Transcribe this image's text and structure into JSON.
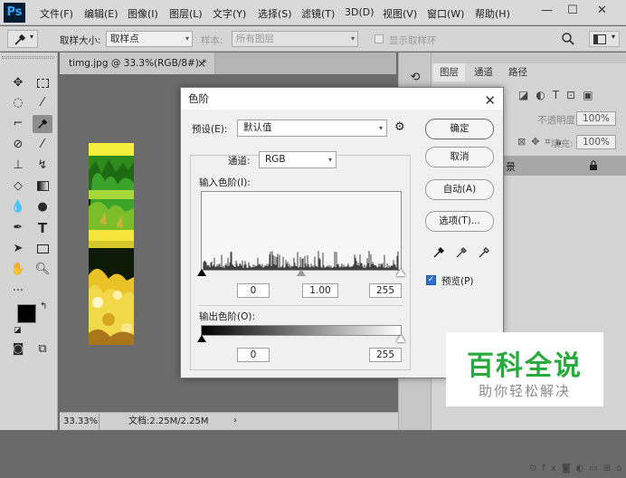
{
  "app": {
    "logo": "Ps"
  },
  "menu": [
    "文件(F)",
    "编辑(E)",
    "图像(I)",
    "图层(L)",
    "文字(Y)",
    "选择(S)",
    "滤镜(T)",
    "3D(D)",
    "视图(V)",
    "窗口(W)",
    "帮助(H)"
  ],
  "window_controls": {
    "minimize": "—",
    "maximize": "☐",
    "close": "✕"
  },
  "options": {
    "sample_size_label": "取样大小:",
    "sample_size_value": "取样点",
    "sample_label": "样本:",
    "sample_value": "所有图层",
    "show_ring": "显示取样环"
  },
  "document": {
    "tab": "timg.jpg @ 33.3%(RGB/8#) *",
    "tab_close": "×",
    "zoom": "33.33%",
    "doc_info": "文档:2.25M/2.25M"
  },
  "panel": {
    "tabs": [
      "图层",
      "通道",
      "路径"
    ],
    "opacity_label": "不透明度:",
    "opacity_value": "100%",
    "fill_label": "填充:",
    "fill_value": "100%",
    "layer_name_fragment": "景"
  },
  "dialog": {
    "title": "色阶",
    "preset_label": "预设(E):",
    "preset_value": "默认值",
    "channel_label": "通道:",
    "channel_value": "RGB",
    "input_label": "输入色阶(I):",
    "input_black": "0",
    "input_gamma": "1.00",
    "input_white": "255",
    "output_label": "输出色阶(O):",
    "output_black": "0",
    "output_white": "255",
    "ok": "确定",
    "cancel": "取消",
    "auto": "自动(A)",
    "options": "选项(T)...",
    "preview": "预览(P)",
    "preview_checked": true
  },
  "watermark": {
    "title": "百科全说",
    "subtitle": "助你轻松解决"
  },
  "colors": {
    "accent": "#31a8ff",
    "ps_bg": "#001d34",
    "watermark_green": "#2aaa3c"
  },
  "icons": [
    "eyedropper-icon",
    "gear-icon",
    "search-icon",
    "panel-toggle-icon",
    "move-icon",
    "marquee-icon",
    "lasso-icon",
    "magic-wand-icon",
    "crop-icon",
    "brush-icon",
    "stamp-icon",
    "eraser-icon",
    "gradient-icon",
    "pen-icon",
    "type-icon",
    "hand-icon",
    "zoom-icon",
    "lock-icon"
  ]
}
